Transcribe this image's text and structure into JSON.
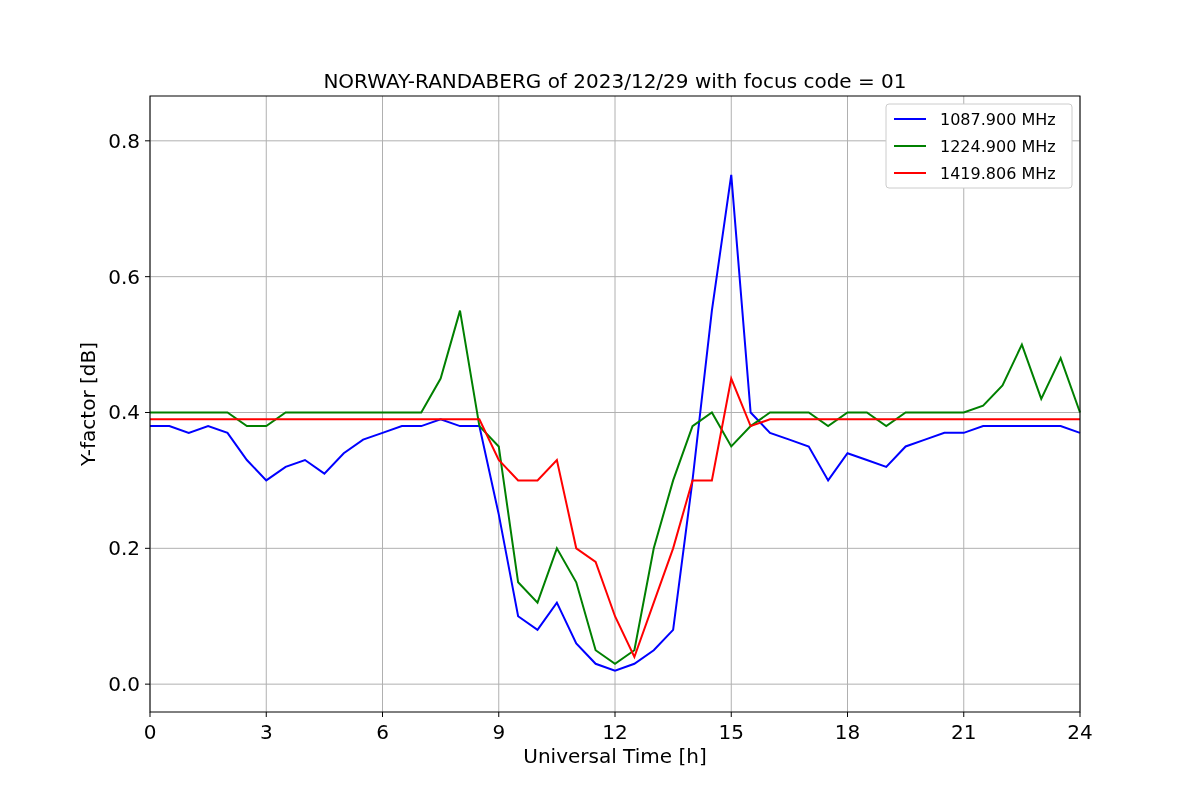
{
  "figure": {
    "chart_data": {
      "type": "line",
      "title": "NORWAY-RANDABERG of 2023/12/29 with focus code = 01",
      "xlabel": "Universal Time [h]",
      "ylabel": "Y-factor [dB]",
      "x": [
        0,
        0.5,
        1,
        1.5,
        2,
        2.5,
        3,
        3.5,
        4,
        4.5,
        5,
        5.5,
        6,
        6.5,
        7,
        7.5,
        8,
        8.5,
        9,
        9.5,
        10,
        10.5,
        11,
        11.5,
        12,
        12.5,
        13,
        13.5,
        14,
        14.5,
        15,
        15.5,
        16,
        16.5,
        17,
        17.5,
        18,
        18.5,
        19,
        19.5,
        20,
        20.5,
        21,
        21.5,
        22,
        22.5,
        23,
        23.5,
        24
      ],
      "series": [
        {
          "name": "1087.900 MHz",
          "color": "#0000ff",
          "values": [
            0.38,
            0.38,
            0.37,
            0.38,
            0.37,
            0.33,
            0.3,
            0.32,
            0.33,
            0.31,
            0.34,
            0.36,
            0.37,
            0.38,
            0.38,
            0.39,
            0.38,
            0.38,
            0.25,
            0.1,
            0.08,
            0.12,
            0.06,
            0.03,
            0.02,
            0.03,
            0.05,
            0.08,
            0.3,
            0.55,
            0.75,
            0.4,
            0.37,
            0.36,
            0.35,
            0.3,
            0.34,
            0.33,
            0.32,
            0.35,
            0.36,
            0.37,
            0.37,
            0.38,
            0.38,
            0.38,
            0.38,
            0.38,
            0.37
          ]
        },
        {
          "name": "1224.900 MHz",
          "color": "#008000",
          "values": [
            0.4,
            0.4,
            0.4,
            0.4,
            0.4,
            0.38,
            0.38,
            0.4,
            0.4,
            0.4,
            0.4,
            0.4,
            0.4,
            0.4,
            0.4,
            0.45,
            0.55,
            0.38,
            0.35,
            0.15,
            0.12,
            0.2,
            0.15,
            0.05,
            0.03,
            0.05,
            0.2,
            0.3,
            0.38,
            0.4,
            0.35,
            0.38,
            0.4,
            0.4,
            0.4,
            0.38,
            0.4,
            0.4,
            0.38,
            0.4,
            0.4,
            0.4,
            0.4,
            0.41,
            0.44,
            0.5,
            0.42,
            0.48,
            0.4
          ]
        },
        {
          "name": "1419.806 MHz",
          "color": "#ff0000",
          "values": [
            0.39,
            0.39,
            0.39,
            0.39,
            0.39,
            0.39,
            0.39,
            0.39,
            0.39,
            0.39,
            0.39,
            0.39,
            0.39,
            0.39,
            0.39,
            0.39,
            0.39,
            0.39,
            0.33,
            0.3,
            0.3,
            0.33,
            0.2,
            0.18,
            0.1,
            0.04,
            0.12,
            0.2,
            0.3,
            0.3,
            0.45,
            0.38,
            0.39,
            0.39,
            0.39,
            0.39,
            0.39,
            0.39,
            0.39,
            0.39,
            0.39,
            0.39,
            0.39,
            0.39,
            0.39,
            0.39,
            0.39,
            0.39,
            0.39
          ]
        }
      ],
      "grid": true,
      "legend": true,
      "xlim": [
        0,
        24
      ],
      "ylim": [
        -0.041,
        0.866
      ],
      "xticks": [
        0,
        3,
        6,
        9,
        12,
        15,
        18,
        21,
        24
      ],
      "yticks": [
        {
          "value": 0,
          "label": "0.0"
        },
        {
          "value": 0.2,
          "label": "0.2"
        },
        {
          "value": 0.4,
          "label": "0.4"
        },
        {
          "value": 0.6,
          "label": "0.6"
        },
        {
          "value": 0.8,
          "label": "0.8"
        }
      ]
    }
  }
}
